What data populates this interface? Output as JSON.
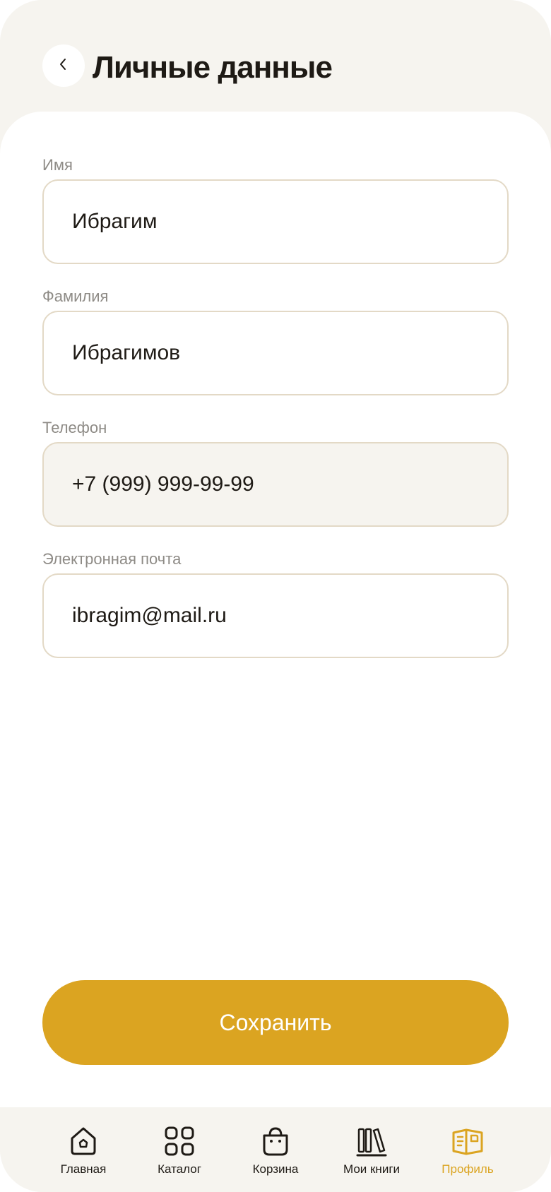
{
  "header": {
    "title": "Личные данные",
    "back_icon": "chevron-left-icon"
  },
  "form": {
    "fields": [
      {
        "label": "Имя",
        "value": "Ибрагим"
      },
      {
        "label": "Фамилия",
        "value": "Ибрагимов"
      },
      {
        "label": "Телефон",
        "value": "+7 (999) 999-99-99"
      },
      {
        "label": "Электронная почта",
        "value": "ibragim@mail.ru"
      }
    ],
    "save_label": "Сохранить"
  },
  "tabbar": {
    "items": [
      {
        "label": "Главная",
        "icon": "home-icon"
      },
      {
        "label": "Каталог",
        "icon": "catalog-grid-icon"
      },
      {
        "label": "Корзина",
        "icon": "basket-icon"
      },
      {
        "label": "Мои книги",
        "icon": "books-icon"
      },
      {
        "label": "Профиль",
        "icon": "profile-book-icon"
      }
    ],
    "active": "Профиль"
  },
  "colors": {
    "accent": "#DBA421",
    "background": "#F6F4EF",
    "text": "#1E1A15",
    "label": "#8E8B86",
    "field_border": "#E3D9C6"
  }
}
